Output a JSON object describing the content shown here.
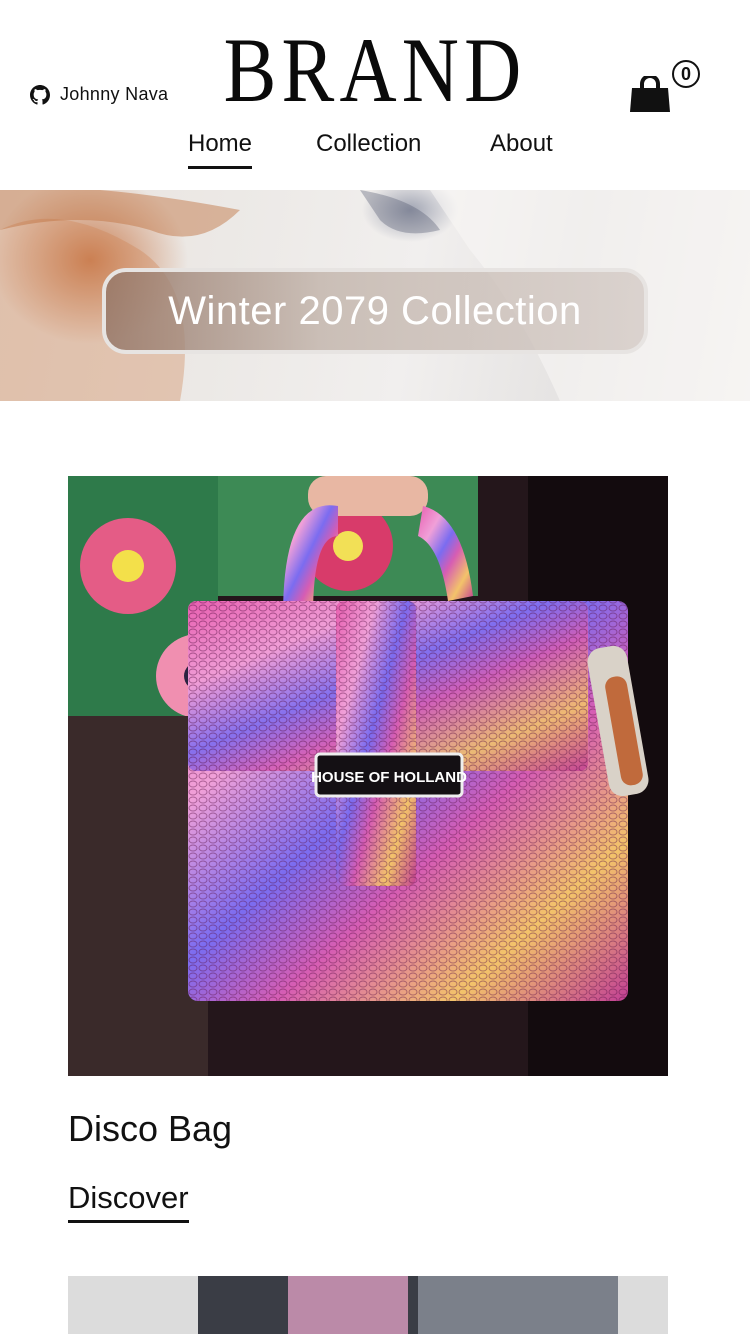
{
  "header": {
    "github_user": "Johnny Nava",
    "brand": "BRAND",
    "cart_count": "0"
  },
  "nav": {
    "items": [
      {
        "label": "Home",
        "active": true
      },
      {
        "label": "Collection",
        "active": false
      },
      {
        "label": "About",
        "active": false
      }
    ]
  },
  "hero": {
    "caption": "Winter 2079 Collection"
  },
  "products": [
    {
      "name": "Disco Bag",
      "cta": "Discover",
      "image_label": "HOUSE OF HOLLAND"
    }
  ],
  "icons": [
    "github-icon",
    "shopping-bag-icon"
  ]
}
